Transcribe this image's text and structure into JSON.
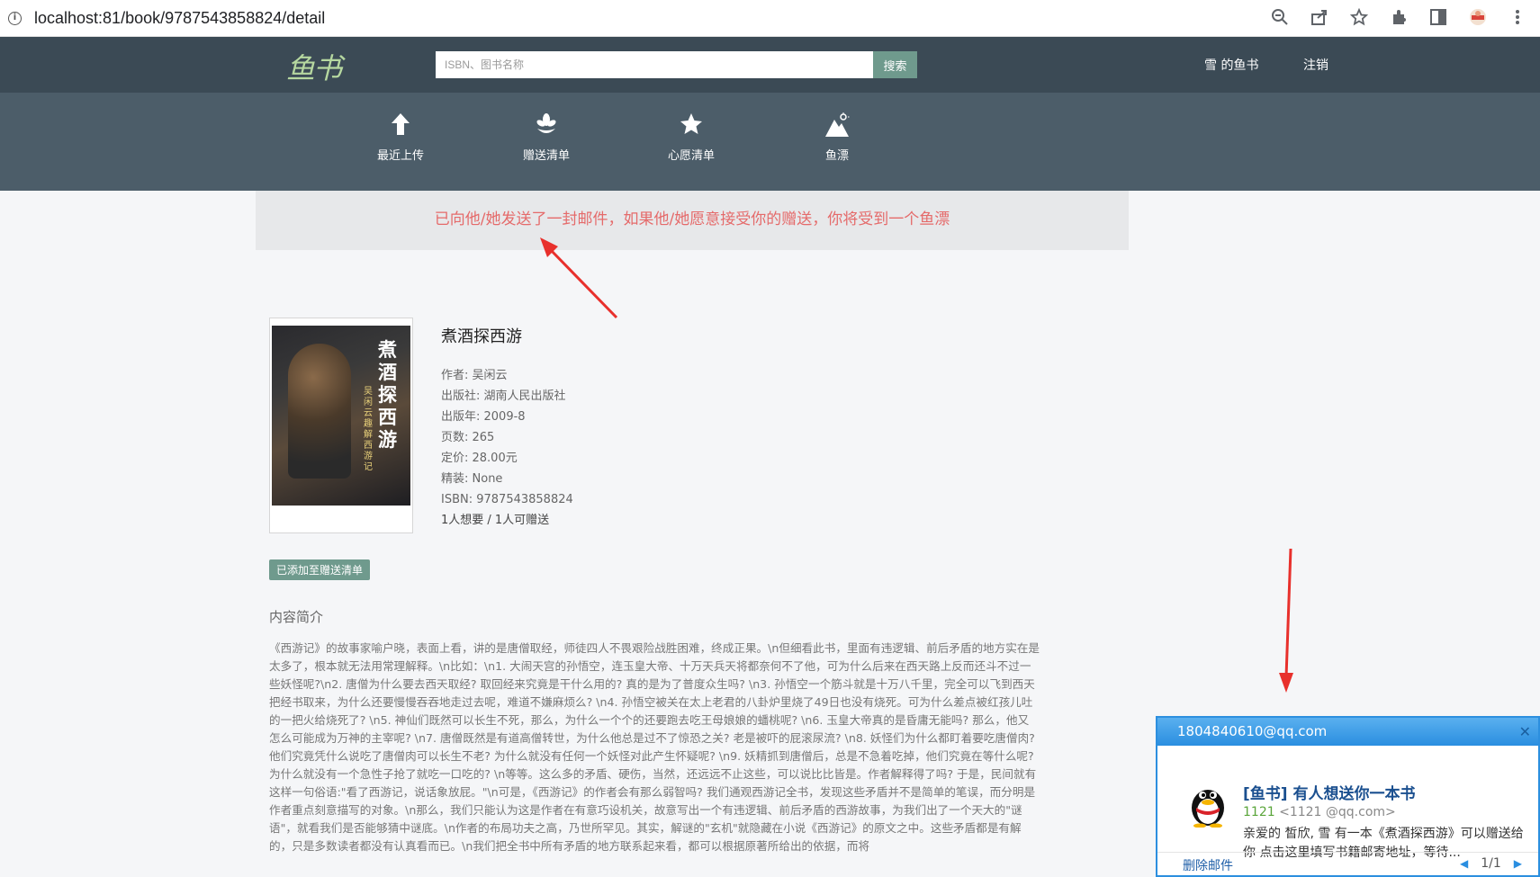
{
  "browser": {
    "url": "localhost:81/book/9787543858824/detail"
  },
  "nav": {
    "logo": "鱼书",
    "search_placeholder": "ISBN、图书名称",
    "search_button": "搜索",
    "user_link": "雪  的鱼书",
    "logout": "注销"
  },
  "subnav": {
    "items": [
      {
        "label": "最近上传",
        "icon": "upload-arrow-icon"
      },
      {
        "label": "赠送清单",
        "icon": "gift-flower-icon"
      },
      {
        "label": "心愿清单",
        "icon": "star-icon"
      },
      {
        "label": "鱼漂",
        "icon": "mountain-icon"
      }
    ]
  },
  "alert": {
    "message": "已向他/她发送了一封邮件，如果他/她愿意接受你的赠送，你将受到一个鱼漂"
  },
  "book": {
    "cover_title": "煮酒探西游",
    "cover_subtitle": "吴闲云趣解西游记",
    "title": "煮酒探西游",
    "author": "作者: 吴闲云",
    "publisher": "出版社: 湖南人民出版社",
    "pubdate": "出版年:   2009-8",
    "pages": "页数:   265",
    "price": "定价:   28.00元",
    "binding": "精装:   None",
    "isbn": "ISBN:   9787543858824",
    "wish_gift": "1人想要 / 1人可赠送",
    "added_badge": "已添加至赠送清单",
    "intro_heading": "内容简介",
    "intro_text": "《西游记》的故事家喻户晓，表面上看，讲的是唐僧取经，师徒四人不畏艰险战胜困难，终成正果。\\n但细看此书，里面有违逻辑、前后矛盾的地方实在是太多了，根本就无法用常理解释。\\n比如：\\n1. 大闹天宫的孙悟空，连玉皇大帝、十万天兵天将都奈何不了他，可为什么后来在西天路上反而还斗不过一些妖怪呢?\\n2. 唐僧为什么要去西天取经? 取回经来究竟是干什么用的? 真的是为了普度众生吗? \\n3. 孙悟空一个筋斗就是十万八千里，完全可以飞到西天把经书取来，为什么还要慢慢吞吞地走过去呢，难道不嫌麻烦么? \\n4. 孙悟空被关在太上老君的八卦炉里烧了49日也没有烧死。可为什么差点被红孩儿吐的一把火给烧死了? \\n5. 神仙们既然可以长生不死，那么，为什么一个个的还要跑去吃王母娘娘的蟠桃呢? \\n6. 玉皇大帝真的是昏庸无能吗? 那么，他又怎么可能成为万神的主宰呢? \\n7. 唐僧既然是有道高僧转世，为什么他总是过不了惊恐之关? 老是被吓的屁滚尿流? \\n8. 妖怪们为什么都盯着要吃唐僧肉? 他们究竟凭什么说吃了唐僧肉可以长生不老? 为什么就没有任何一个妖怪对此产生怀疑呢? \\n9. 妖精抓到唐僧后，总是不急着吃掉，他们究竟在等什么呢? 为什么就没有一个急性子抢了就吃一口吃的? \\n等等。这么多的矛盾、硬伤，当然，还远远不止这些，可以说比比皆是。作者解释得了吗? 于是，民间就有这样一句俗语:\"看了西游记，说话象放屁。\"\\n可是，《西游记》的作者会有那么弱智吗? 我们通观西游记全书，发现这些矛盾并不是简单的笔误，而分明是作者重点刻意描写的对象。\\n那么，我们只能认为这是作者在有意巧设机关，故意写出一个有违逻辑、前后矛盾的西游故事，为我们出了一个天大的\"谜语\"，就看我们是否能够猜中谜底。\\n作者的布局功夫之高，乃世所罕见。其实，解谜的\"玄机\"就隐藏在小说《西游记》的原文之中。这些矛盾都是有解的，只是多数读者都没有认真看而已。\\n我们把全书中所有矛盾的地方联系起来看，都可以根据原著所给出的依据，而将"
  },
  "mail": {
    "sender": "1804840610@qq.com",
    "subject": "[鱼书] 有人想送你一本书",
    "from_name": "1121",
    "from_addr": "<1121          @qq.com>",
    "preview": "亲爱的 皙欣, 雪  有一本《煮酒探西游》可以赠送给你 点击这里填写书籍邮寄地址，等待...",
    "delete": "删除邮件",
    "pager": "1/1"
  },
  "colors": {
    "nav_bg": "#3b4a55",
    "subnav_bg": "#4c5d69",
    "accent": "#6f9a8d",
    "alert_text": "#e56a6a",
    "annotation_arrow": "#e8302c"
  }
}
